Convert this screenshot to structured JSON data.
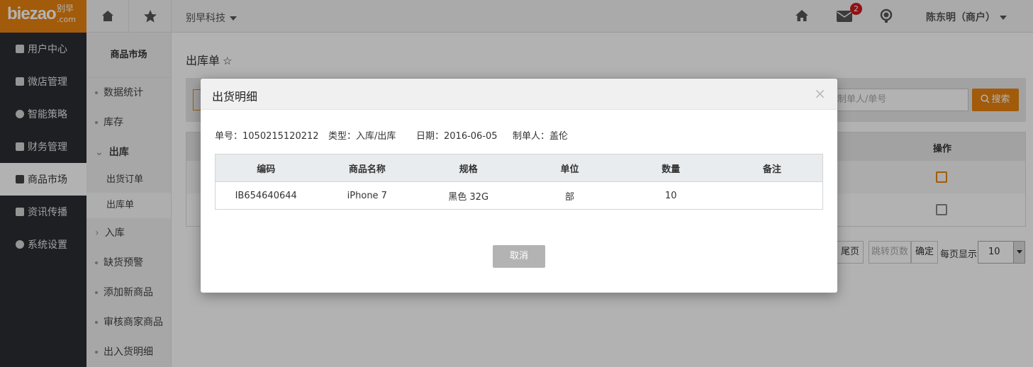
{
  "topbar": {
    "logo_text": "biezao",
    "logo_cn": "别早",
    "logo_sub": ".com",
    "company": "别早科技",
    "mail_badge": "2",
    "user": "陈东明（商户）"
  },
  "sidebar": {
    "items": [
      {
        "label": "用户中心",
        "icon": "user-icon"
      },
      {
        "label": "微店管理",
        "icon": "shop-icon"
      },
      {
        "label": "智能策略",
        "icon": "strategy-icon"
      },
      {
        "label": "财务管理",
        "icon": "finance-icon"
      },
      {
        "label": "商品市场",
        "icon": "market-icon",
        "active": true
      },
      {
        "label": "资讯传播",
        "icon": "news-icon"
      },
      {
        "label": "系统设置",
        "icon": "gear-icon"
      }
    ]
  },
  "subsidebar": {
    "title": "商品市场",
    "items": [
      "数据统计",
      "库存",
      "出库",
      "出货订单",
      "出库单",
      "入库",
      "缺货预警",
      "添加新商品",
      "审核商家商品",
      "出入货明细"
    ]
  },
  "main": {
    "title": "出库单",
    "search_placeholder": "制单人/单号",
    "search_button": "搜索",
    "op_header": "操作",
    "pager_last": "尾页",
    "pager_jump": "跳转页数",
    "pager_confirm": "确定",
    "per_page_label": "每页显示",
    "per_page_value": "10"
  },
  "modal": {
    "title": "出货明细",
    "close": "×",
    "meta": {
      "number": "单号：1050215120212",
      "type": "类型：入库/出库",
      "date": "日期：2016-06-05",
      "maker": "制单人：盖伦"
    },
    "columns": [
      "编码",
      "商品名称",
      "规格",
      "单位",
      "数量",
      "备注"
    ],
    "rows": [
      [
        "IB654640644",
        "iPhone 7",
        "黑色 32G",
        "部",
        "10",
        ""
      ]
    ],
    "cancel": "取消"
  }
}
